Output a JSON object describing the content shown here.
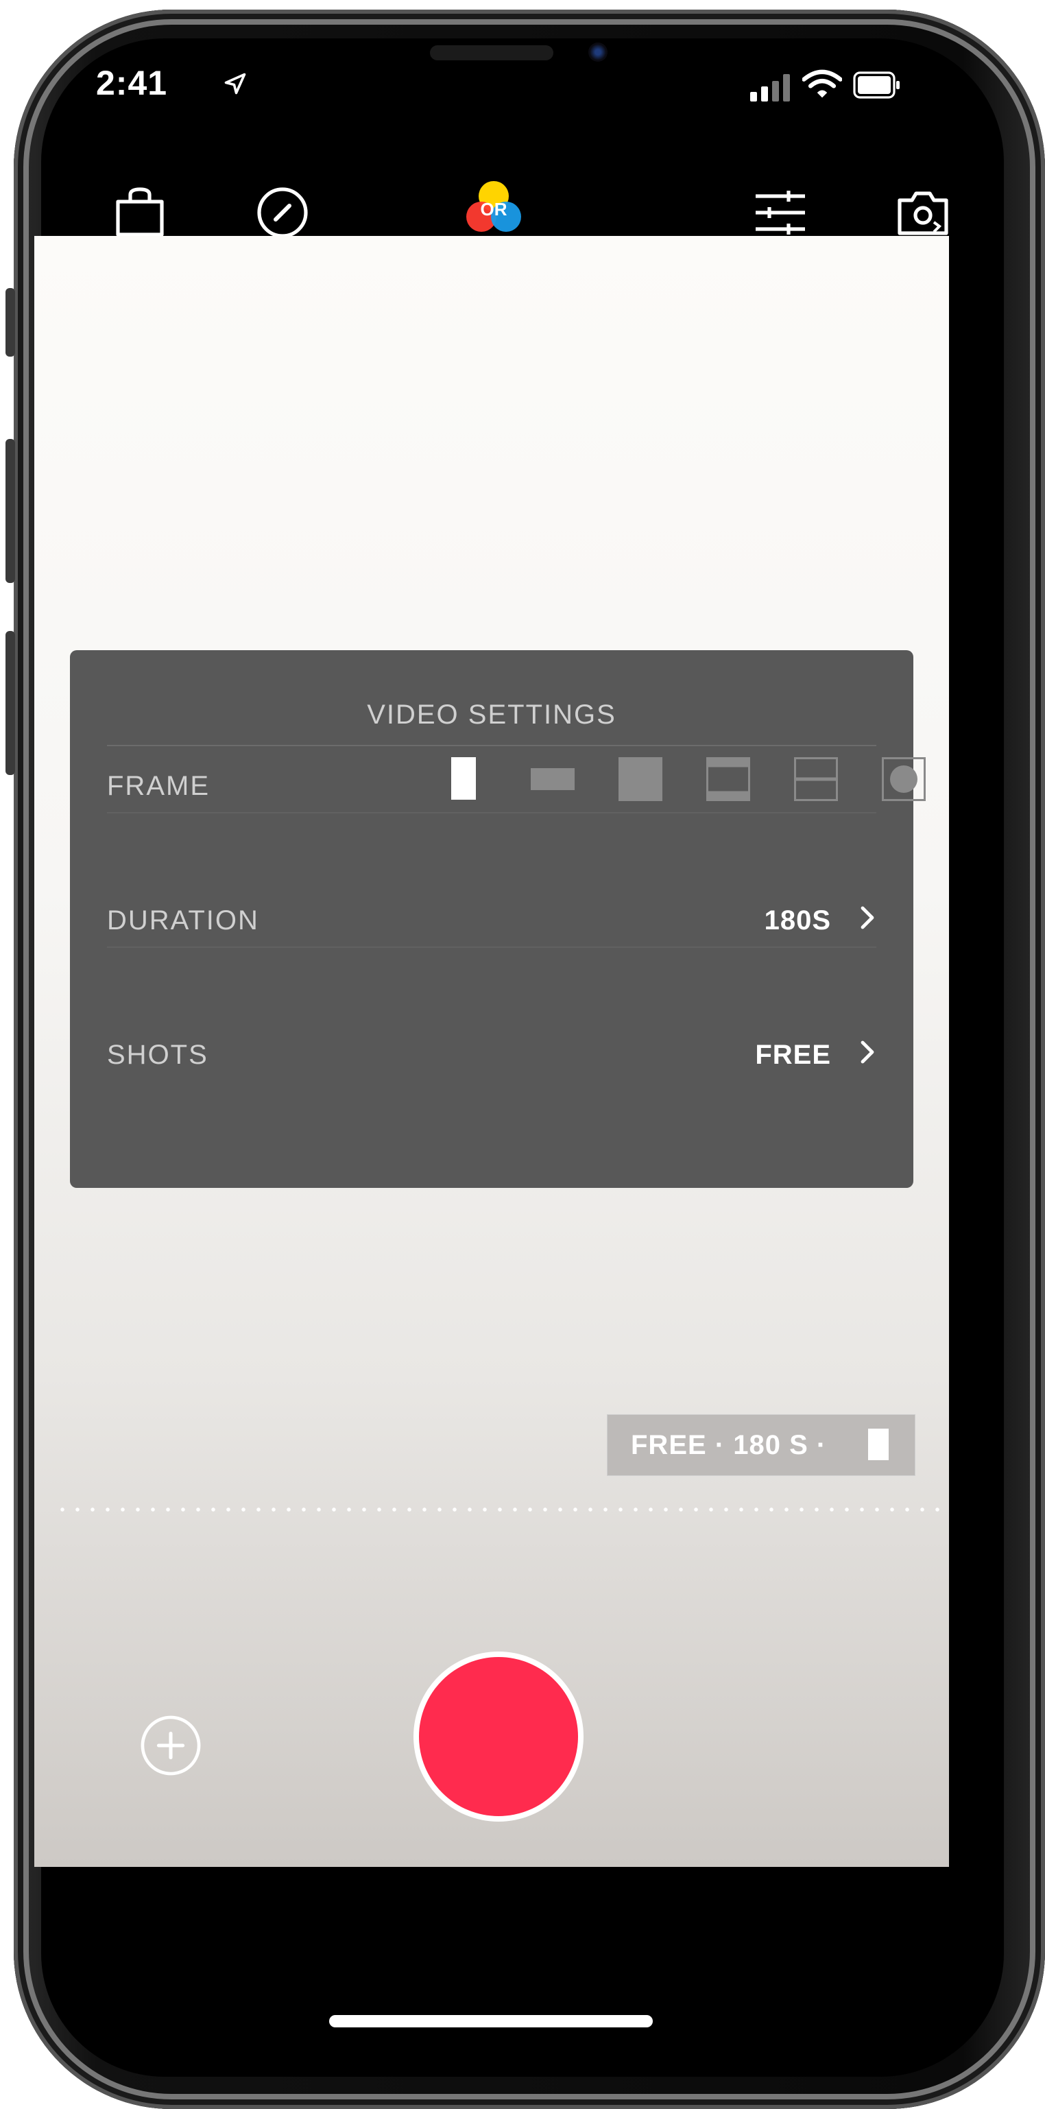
{
  "status_bar": {
    "time": "2:41"
  },
  "top_bar": {
    "logo_text": "OR"
  },
  "video_settings": {
    "title": "VIDEO SETTINGS",
    "frame_label": "FRAME",
    "duration_label": "DURATION",
    "duration_value": "180S",
    "shots_label": "SHOTS",
    "shots_value": "FREE"
  },
  "summary": {
    "text": "FREE  ·  180 S  ·"
  },
  "colors": {
    "record": "#ff2b4e",
    "panel": "#585858",
    "logo_yellow": "#ffd400",
    "logo_red": "#ff3b30",
    "logo_blue": "#1a9be8"
  },
  "icons": [
    "location-arrow-icon",
    "signal-icon",
    "wifi-icon",
    "battery-icon",
    "shopping-bag-icon",
    "compass-icon",
    "sliders-icon",
    "camera-flip-icon",
    "chevron-right-icon",
    "add-icon"
  ]
}
